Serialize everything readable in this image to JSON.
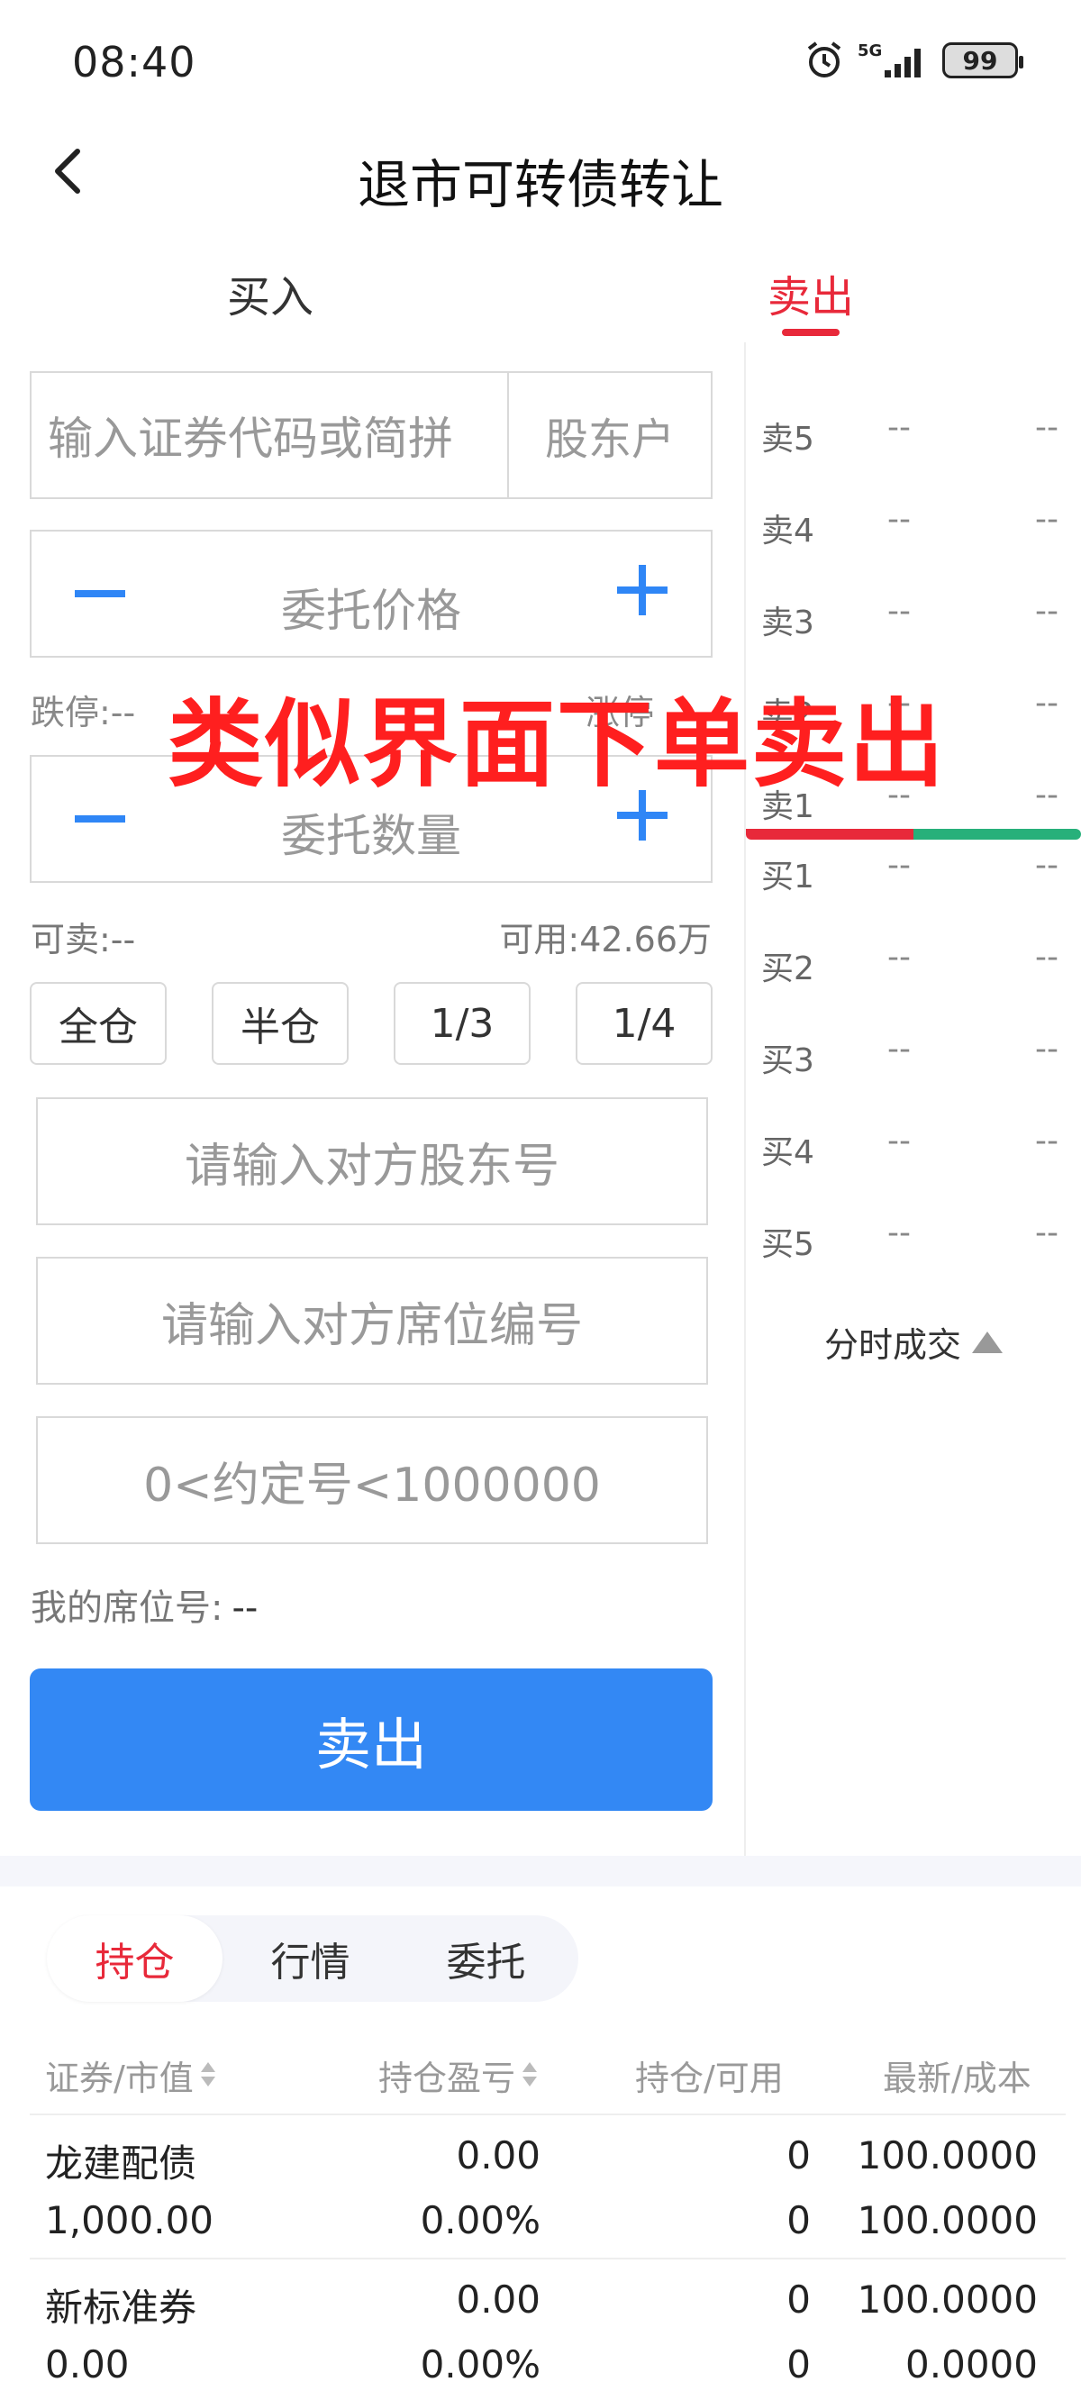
{
  "status_bar": {
    "time": "08:40",
    "network": "5G",
    "battery": "99"
  },
  "header": {
    "title": "退市可转债转让"
  },
  "trade_tabs": {
    "buy": "买入",
    "sell": "卖出",
    "active": "sell"
  },
  "form": {
    "code_placeholder": "输入证券代码或简拼",
    "holder_account": "股东户",
    "price_placeholder": "委托价格",
    "quantity_placeholder": "委托数量",
    "limit_down": "跌停:--",
    "limit_up": "涨停",
    "sellable": "可卖:--",
    "available": "可用:42.66万",
    "position_buttons": [
      "全仓",
      "半仓",
      "1/3",
      "1/4"
    ],
    "counterparty_holder_placeholder": "请输入对方股东号",
    "counterparty_seat_placeholder": "请输入对方席位编号",
    "agreement_placeholder": "0<约定号<1000000",
    "my_seat_label": "我的席位号:",
    "my_seat_value": "--",
    "submit_label": "卖出"
  },
  "order_book": {
    "sell": [
      {
        "label": "卖5",
        "price": "--",
        "volume": "--"
      },
      {
        "label": "卖4",
        "price": "--",
        "volume": "--"
      },
      {
        "label": "卖3",
        "price": "--",
        "volume": "--"
      },
      {
        "label": "卖2",
        "price": "--",
        "volume": "--"
      },
      {
        "label": "卖1",
        "price": "--",
        "volume": "--"
      }
    ],
    "buy": [
      {
        "label": "买1",
        "price": "--",
        "volume": "--"
      },
      {
        "label": "买2",
        "price": "--",
        "volume": "--"
      },
      {
        "label": "买3",
        "price": "--",
        "volume": "--"
      },
      {
        "label": "买4",
        "price": "--",
        "volume": "--"
      },
      {
        "label": "买5",
        "price": "--",
        "volume": "--"
      }
    ],
    "timeshare_label": "分时成交"
  },
  "overlay_caption": "类似界面下单卖出",
  "bottom_tabs": {
    "items": [
      "持仓",
      "行情",
      "委托"
    ],
    "active": 0
  },
  "holdings": {
    "headers": [
      "证券/市值",
      "持仓盈亏",
      "持仓/可用",
      "最新/成本"
    ],
    "rows": [
      {
        "name": "龙建配债",
        "market_value": "1,000.00",
        "pnl": "0.00",
        "pnl_pct": "0.00%",
        "position": "0",
        "available": "0",
        "latest": "100.0000",
        "cost": "100.0000"
      },
      {
        "name": "新标准券",
        "market_value": "0.00",
        "pnl": "0.00",
        "pnl_pct": "0.00%",
        "position": "0",
        "available": "0",
        "latest": "100.0000",
        "cost": "0.0000"
      }
    ]
  },
  "colors": {
    "accent_red": "#e8293a",
    "accent_blue": "#3388f4",
    "green": "#27b07a"
  }
}
